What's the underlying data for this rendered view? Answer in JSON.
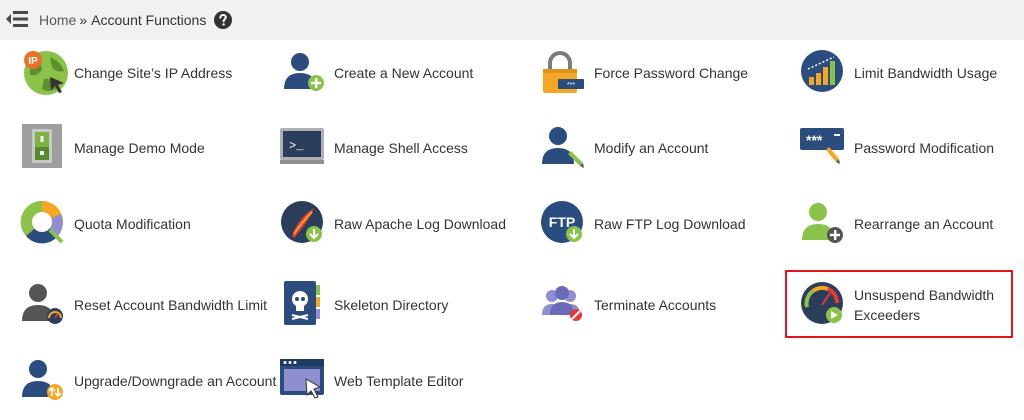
{
  "breadcrumb": {
    "home": "Home",
    "separator": "»",
    "current": "Account Functions"
  },
  "icons": {
    "menu": "menu-collapse-icon",
    "help": "question-circle-icon"
  },
  "colors": {
    "topbar": "#f1f1f1",
    "highlight_border": "#e2161d",
    "icon_blue": "#1f4e79",
    "icon_green": "#7cb342",
    "icon_orange": "#f39c12"
  },
  "functions": [
    {
      "label": "Change Site’s IP Address",
      "icon": "ip-globe-icon"
    },
    {
      "label": "Create a New Account",
      "icon": "user-add-icon"
    },
    {
      "label": "Force Password Change",
      "icon": "padlock-icon"
    },
    {
      "label": "Limit Bandwidth Usage",
      "icon": "bandwidth-bars-icon"
    },
    {
      "label": "Manage Demo Mode",
      "icon": "switch-icon"
    },
    {
      "label": "Manage Shell Access",
      "icon": "terminal-icon"
    },
    {
      "label": "Modify an Account",
      "icon": "user-edit-icon"
    },
    {
      "label": "Password Modification",
      "icon": "password-field-icon"
    },
    {
      "label": "Quota Modification",
      "icon": "pie-quota-icon"
    },
    {
      "label": "Raw Apache Log Download",
      "icon": "apache-feather-download-icon"
    },
    {
      "label": "Raw FTP Log Download",
      "icon": "ftp-download-icon"
    },
    {
      "label": "Rearrange an Account",
      "icon": "user-rearrange-icon"
    },
    {
      "label": "Reset Account Bandwidth Limit",
      "icon": "user-gauge-icon"
    },
    {
      "label": "Skeleton Directory",
      "icon": "skull-book-icon"
    },
    {
      "label": "Terminate Accounts",
      "icon": "users-remove-icon"
    },
    {
      "label": "Unsuspend Bandwidth Exceeders",
      "icon": "gauge-play-icon"
    },
    {
      "label": "Upgrade/Downgrade an Account",
      "icon": "user-updown-icon"
    },
    {
      "label": "Web Template Editor",
      "icon": "browser-edit-icon"
    }
  ]
}
